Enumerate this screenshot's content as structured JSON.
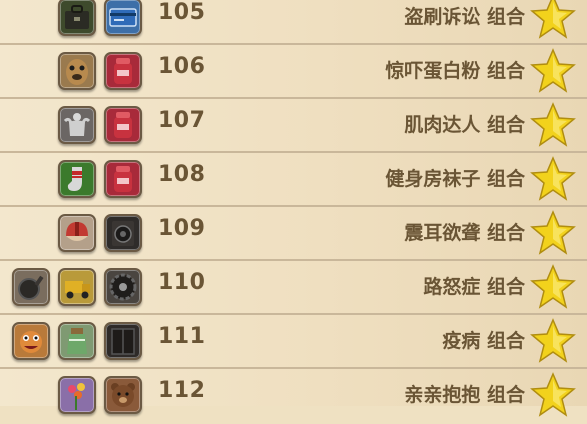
{
  "achievements": [
    {
      "number": "105",
      "name": "盗刷诉讼 组合",
      "icons": [
        "bag-icon",
        "credit-card-icon"
      ]
    },
    {
      "number": "106",
      "name": "惊吓蛋白粉 组合",
      "icons": [
        "dog-mask-icon",
        "protein-tub-icon"
      ]
    },
    {
      "number": "107",
      "name": "肌肉达人 组合",
      "icons": [
        "muscle-statue-icon",
        "protein-tub-icon"
      ]
    },
    {
      "number": "108",
      "name": "健身房袜子 组合",
      "icons": [
        "sock-icon",
        "protein-tub-icon"
      ]
    },
    {
      "number": "109",
      "name": "震耳欲聋 组合",
      "icons": [
        "helmet-icon",
        "speaker-icon"
      ]
    },
    {
      "number": "110",
      "name": "路怒症 组合",
      "icons": [
        "frying-pan-icon",
        "truck-icon",
        "tire-icon"
      ]
    },
    {
      "number": "111",
      "name": "疫病 组合",
      "icons": [
        "monster-icon",
        "potion-jar-icon",
        "cabinet-icon"
      ]
    },
    {
      "number": "112",
      "name": "亲亲抱抱 组合",
      "icons": [
        "flowers-icon",
        "teddy-bear-icon"
      ]
    }
  ],
  "colors": {
    "paper": "#efe1c2",
    "rule_line": "#c9b79a",
    "text": "#6a5535",
    "star": "#f2d21c"
  }
}
